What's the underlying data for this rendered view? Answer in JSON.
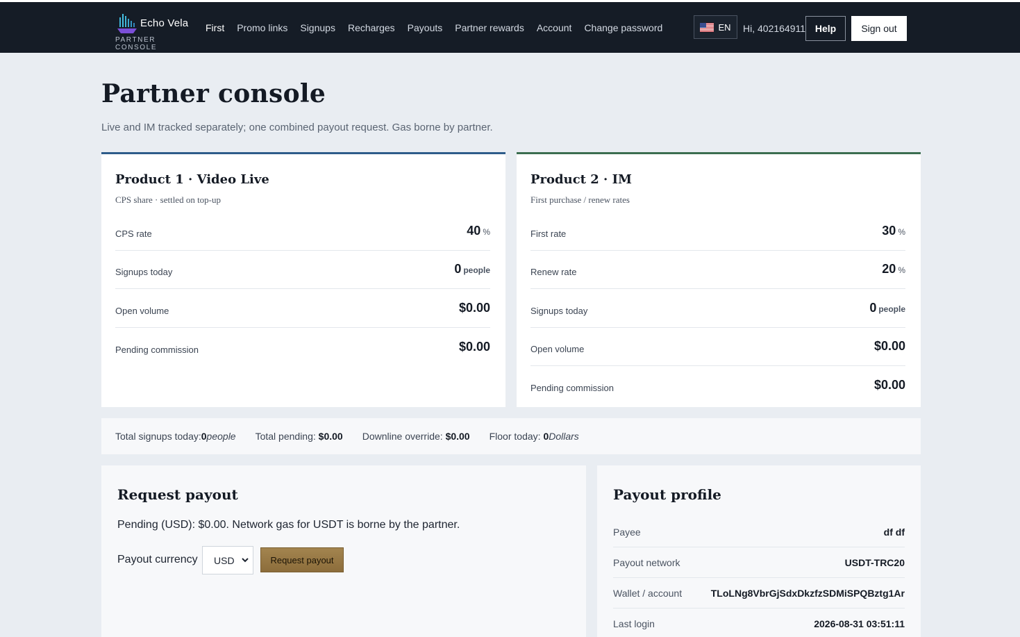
{
  "brand": {
    "name": "Echo Vela",
    "subtitle": "PARTNER CONSOLE"
  },
  "nav": [
    {
      "label": "First",
      "active": true
    },
    {
      "label": "Promo links"
    },
    {
      "label": "Signups"
    },
    {
      "label": "Recharges"
    },
    {
      "label": "Payouts"
    },
    {
      "label": "Partner rewards"
    },
    {
      "label": "Account"
    },
    {
      "label": "Change password"
    }
  ],
  "header_right": {
    "lang": "EN",
    "lang_icon": "us-flag-icon",
    "greeting": "Hi, 402164911",
    "help": "Help",
    "signout": "Sign out"
  },
  "page": {
    "title": "Partner console",
    "subtitle": "Live and IM tracked separately; one combined payout request. Gas borne by partner."
  },
  "product1": {
    "title": "Product 1 · Video Live",
    "subtitle": "CPS share · settled on top-up",
    "accent": "#2e5c8a",
    "rows": [
      {
        "label": "CPS rate",
        "value": "40",
        "unit": "%"
      },
      {
        "label": "Signups today",
        "value": "0",
        "unit": "people"
      },
      {
        "label": "Open volume",
        "value": "$0.00",
        "unit": ""
      },
      {
        "label": "Pending commission",
        "value": "$0.00",
        "unit": ""
      }
    ]
  },
  "product2": {
    "title": "Product 2 · IM",
    "subtitle": "First purchase / renew rates",
    "accent": "#3b6e50",
    "rows": [
      {
        "label": "First rate",
        "value": "30",
        "unit": "%"
      },
      {
        "label": "Renew rate",
        "value": "20",
        "unit": "%"
      },
      {
        "label": "Signups today",
        "value": "0",
        "unit": "people"
      },
      {
        "label": "Open volume",
        "value": "$0.00",
        "unit": ""
      },
      {
        "label": "Pending commission",
        "value": "$0.00",
        "unit": ""
      }
    ]
  },
  "summary": {
    "signups_label": "Total signups today:",
    "signups_value": "0",
    "signups_unit": "people",
    "pending_label": "Total pending:",
    "pending_value": "$0.00",
    "override_label": "Downline override:",
    "override_value": "$0.00",
    "floor_label": "Floor today:",
    "floor_value": "0",
    "floor_unit": "Dollars"
  },
  "request_payout": {
    "title": "Request payout",
    "note": "Pending (USD): $0.00. Network gas for USDT is borne by the partner.",
    "currency_label": "Payout currency",
    "currency_selected": "USD",
    "button": "Request payout"
  },
  "payout_profile": {
    "title": "Payout profile",
    "rows": [
      {
        "label": "Payee",
        "value": "df df"
      },
      {
        "label": "Payout network",
        "value": "USDT-TRC20"
      },
      {
        "label": "Wallet / account",
        "value": "TLoLNg8VbrGjSdxDkzfzSDMiSPQBztg1Ar"
      },
      {
        "label": "Last login",
        "value": "2026-08-31 03:51:11"
      }
    ]
  }
}
